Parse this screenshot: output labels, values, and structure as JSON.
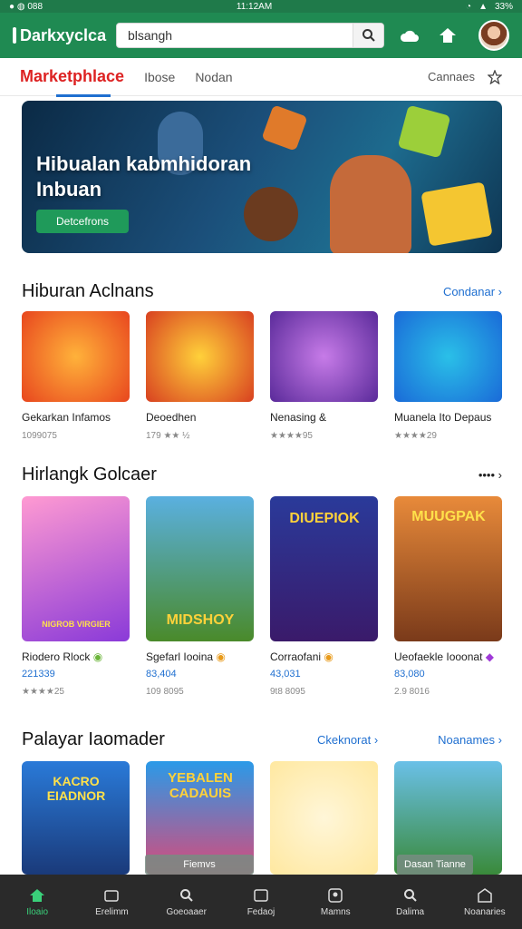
{
  "statusbar": {
    "left": "● ◍ 088",
    "time": "11:12AM",
    "battery": "33%"
  },
  "appbar": {
    "logo": "Darkxyclca",
    "search_placeholder": "blsangh",
    "search_value": "blsangh"
  },
  "tabs": {
    "brand": "Marketphlace",
    "items": [
      "Ibose",
      "Nodan"
    ],
    "right": "Cannaes"
  },
  "hero": {
    "title": "Hibualan kabmhidoran Inbuan",
    "cta": "Detcefrons"
  },
  "sections": [
    {
      "title": "Hiburan Aclnans",
      "more": "Condanar",
      "cards": [
        {
          "name": "Gekarkan Infamos",
          "meta": "1099075"
        },
        {
          "name": "Deoedhen",
          "meta": "179 ★★ ½"
        },
        {
          "name": "Nenasing &",
          "meta": "★★★★95"
        },
        {
          "name": "Muanela Ito Depaus",
          "meta": "★★★★29"
        }
      ]
    },
    {
      "title": "Hirlangk Golcaer",
      "more": "•••• ",
      "cards": [
        {
          "name": "Riodero Rlock",
          "price": "221339",
          "meta": "★★★★25",
          "tile_text": "NIGROB VIRGIER"
        },
        {
          "name": "Sgefarl Iooina",
          "price": "83,404",
          "meta": "109 8095",
          "tile_text": "MIDSHOY"
        },
        {
          "name": "Corraofani",
          "price": "43,031",
          "meta": "9t8 8095",
          "tile_text": "DIUEPIOK"
        },
        {
          "name": "Ueofaekle Iooonat",
          "price": "83,080",
          "meta": "2.9 8016",
          "tile_text": "MUUGPAK"
        }
      ]
    },
    {
      "title": "Palayar Iaomader",
      "more_left": "Ckeknorat",
      "more": "Noanames",
      "cards": [
        {
          "tile_text": "KACRO EIADNOR"
        },
        {
          "tile_text": "YEBALEN CADAUIS"
        },
        {
          "tile_text": ""
        },
        {
          "tile_text": ""
        }
      ]
    }
  ],
  "overlay": {
    "left": "Fiemvs",
    "right": "Dasan Tianne"
  },
  "bottomnav": [
    "Iloaio",
    "Erelimm",
    "Goeoaaer",
    "Fedaoj",
    "Mamns",
    "Dalima",
    "Noanaries"
  ],
  "colors": {
    "brand_green": "#1f8a52",
    "accent_blue": "#1f6fd0",
    "nav_bg": "#2a2a2a",
    "active": "#3ad07a"
  }
}
